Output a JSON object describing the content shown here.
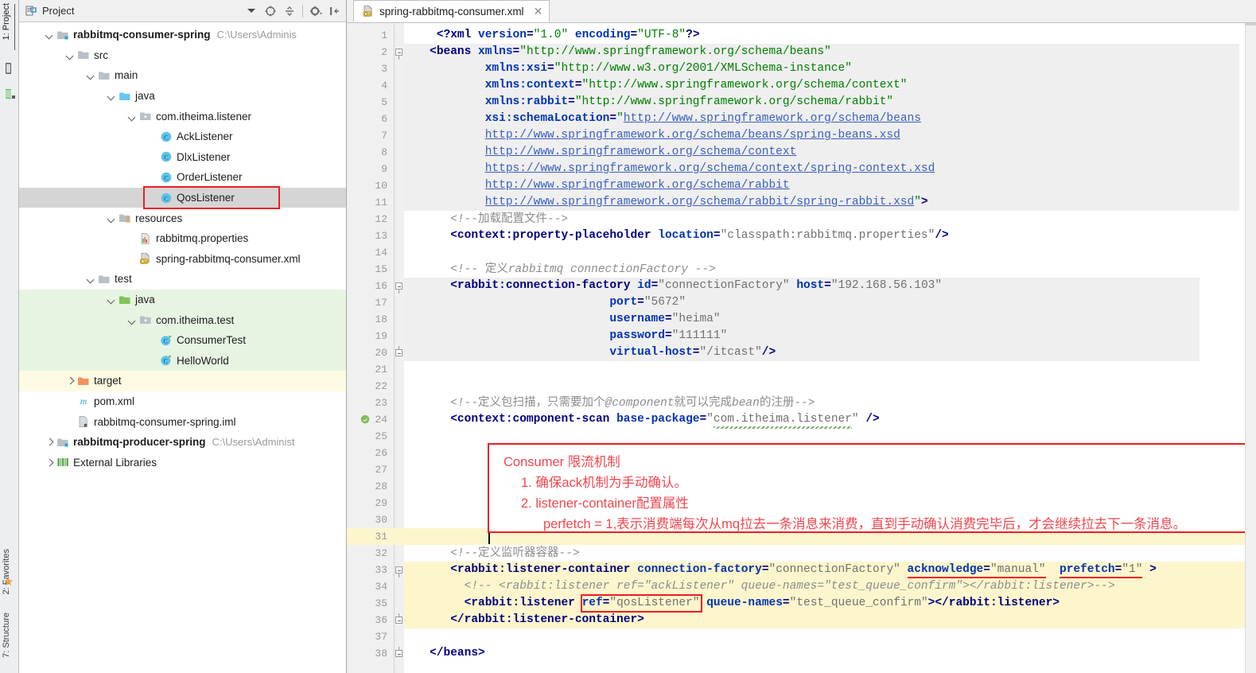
{
  "tool_strip": {
    "tabs": [
      {
        "name": "project",
        "label": "1: Project"
      },
      {
        "name": "favorites",
        "label": "2: Favorites"
      },
      {
        "name": "structure",
        "label": "7: Structure"
      }
    ],
    "star_icon": "star-icon"
  },
  "project_panel": {
    "title": "Project",
    "dropdown_icon": "chevron-down-icon",
    "toolbar_icons": [
      "locate-target-icon",
      "collapse-all-icon",
      "settings-gear-icon",
      "hide-panel-icon"
    ],
    "tree": [
      {
        "depth": 0,
        "arrow": "down",
        "icon": "module-icon",
        "label": "rabbitmq-consumer-spring",
        "bold": true,
        "path": "C:\\Users\\Adminis",
        "state": "normal"
      },
      {
        "depth": 1,
        "arrow": "down",
        "icon": "folder-icon",
        "label": "src",
        "bold": false,
        "path": "",
        "state": "normal"
      },
      {
        "depth": 2,
        "arrow": "down",
        "icon": "folder-icon",
        "label": "main",
        "bold": false,
        "path": "",
        "state": "normal"
      },
      {
        "depth": 3,
        "arrow": "down",
        "icon": "source-root-icon",
        "label": "java",
        "bold": false,
        "path": "",
        "state": "normal"
      },
      {
        "depth": 4,
        "arrow": "down",
        "icon": "package-icon",
        "label": "com.itheima.listener",
        "bold": false,
        "path": "",
        "state": "normal"
      },
      {
        "depth": 5,
        "arrow": "none",
        "icon": "class-icon",
        "label": "AckListener",
        "bold": false,
        "path": "",
        "state": "normal"
      },
      {
        "depth": 5,
        "arrow": "none",
        "icon": "class-icon",
        "label": "DlxListener",
        "bold": false,
        "path": "",
        "state": "normal"
      },
      {
        "depth": 5,
        "arrow": "none",
        "icon": "class-icon",
        "label": "OrderListener",
        "bold": false,
        "path": "",
        "state": "normal"
      },
      {
        "depth": 5,
        "arrow": "none",
        "icon": "class-icon",
        "label": "QosListener",
        "bold": false,
        "path": "",
        "state": "selected"
      },
      {
        "depth": 3,
        "arrow": "down",
        "icon": "resource-root-icon",
        "label": "resources",
        "bold": false,
        "path": "",
        "state": "normal"
      },
      {
        "depth": 4,
        "arrow": "none",
        "icon": "properties-file-icon",
        "label": "rabbitmq.properties",
        "bold": false,
        "path": "",
        "state": "normal"
      },
      {
        "depth": 4,
        "arrow": "none",
        "icon": "spring-xml-icon",
        "label": "spring-rabbitmq-consumer.xml",
        "bold": false,
        "path": "",
        "state": "normal"
      },
      {
        "depth": 2,
        "arrow": "down",
        "icon": "folder-icon",
        "label": "test",
        "bold": false,
        "path": "",
        "state": "normal"
      },
      {
        "depth": 3,
        "arrow": "down",
        "icon": "test-source-root-icon",
        "label": "java",
        "bold": false,
        "path": "",
        "state": "green"
      },
      {
        "depth": 4,
        "arrow": "down",
        "icon": "package-icon",
        "label": "com.itheima.test",
        "bold": false,
        "path": "",
        "state": "green"
      },
      {
        "depth": 5,
        "arrow": "none",
        "icon": "test-class-icon",
        "label": "ConsumerTest",
        "bold": false,
        "path": "",
        "state": "green"
      },
      {
        "depth": 5,
        "arrow": "none",
        "icon": "test-class-icon",
        "label": "HelloWorld",
        "bold": false,
        "path": "",
        "state": "green"
      },
      {
        "depth": 1,
        "arrow": "right",
        "icon": "excluded-folder-icon",
        "label": "target",
        "bold": false,
        "path": "",
        "state": "yellow"
      },
      {
        "depth": 1,
        "arrow": "none",
        "icon": "maven-pom-icon",
        "label": "pom.xml",
        "bold": false,
        "path": "",
        "state": "normal"
      },
      {
        "depth": 1,
        "arrow": "none",
        "icon": "iml-file-icon",
        "label": "rabbitmq-consumer-spring.iml",
        "bold": false,
        "path": "",
        "state": "normal"
      },
      {
        "depth": 0,
        "arrow": "right",
        "icon": "module-icon",
        "label": "rabbitmq-producer-spring",
        "bold": true,
        "path": "C:\\Users\\Administ",
        "state": "normal"
      },
      {
        "depth": 0,
        "arrow": "right",
        "icon": "libraries-icon",
        "label": "External Libraries",
        "bold": false,
        "path": "",
        "state": "normal"
      }
    ],
    "highlight_row_index": 8
  },
  "editor": {
    "tab": {
      "label": "spring-rabbitmq-consumer.xml",
      "icon": "spring-xml-icon",
      "close_icon": "close-icon"
    },
    "first_line": 1,
    "last_line": 38,
    "cursor_line": 31,
    "lines": [
      {
        "n": 1,
        "segs": [
          [
            "plain",
            "    "
          ],
          [
            "punc",
            "<?"
          ],
          [
            "tagname",
            "xml"
          ],
          [
            "plain",
            " "
          ],
          [
            "attr",
            "version"
          ],
          [
            "punc",
            "="
          ],
          [
            "strq",
            "\"1.0\""
          ],
          [
            "plain",
            " "
          ],
          [
            "attr",
            "encoding"
          ],
          [
            "punc",
            "="
          ],
          [
            "strq",
            "\"UTF-8\""
          ],
          [
            "punc",
            "?>"
          ]
        ]
      },
      {
        "n": 2,
        "segs": [
          [
            "plain",
            "   "
          ],
          [
            "punc",
            "<"
          ],
          [
            "tagname",
            "beans"
          ],
          [
            "plain",
            " "
          ],
          [
            "attr",
            "xmlns"
          ],
          [
            "punc",
            "="
          ],
          [
            "strq",
            "\"http://www.springframework.org/schema/beans\""
          ]
        ]
      },
      {
        "n": 3,
        "segs": [
          [
            "plain",
            "           "
          ],
          [
            "attr",
            "xmlns:xsi"
          ],
          [
            "punc",
            "="
          ],
          [
            "strq",
            "\"http://www.w3.org/2001/XMLSchema-instance\""
          ]
        ]
      },
      {
        "n": 4,
        "segs": [
          [
            "plain",
            "           "
          ],
          [
            "attr",
            "xmlns:context"
          ],
          [
            "punc",
            "="
          ],
          [
            "strq",
            "\"http://www.springframework.org/schema/context\""
          ]
        ]
      },
      {
        "n": 5,
        "segs": [
          [
            "plain",
            "           "
          ],
          [
            "attr",
            "xmlns:rabbit"
          ],
          [
            "punc",
            "="
          ],
          [
            "strq",
            "\"http://www.springframework.org/schema/rabbit\""
          ]
        ]
      },
      {
        "n": 6,
        "segs": [
          [
            "plain",
            "           "
          ],
          [
            "attr",
            "xsi:schemaLocation"
          ],
          [
            "punc",
            "="
          ],
          [
            "strq",
            "\""
          ],
          [
            "url",
            "http://www.springframework.org/schema/beans"
          ]
        ]
      },
      {
        "n": 7,
        "segs": [
          [
            "plain",
            "           "
          ],
          [
            "url",
            "http://www.springframework.org/schema/beans/spring-beans.xsd"
          ]
        ]
      },
      {
        "n": 8,
        "segs": [
          [
            "plain",
            "           "
          ],
          [
            "url",
            "http://www.springframework.org/schema/context"
          ]
        ]
      },
      {
        "n": 9,
        "segs": [
          [
            "plain",
            "           "
          ],
          [
            "url",
            "https://www.springframework.org/schema/context/spring-context.xsd"
          ]
        ]
      },
      {
        "n": 10,
        "segs": [
          [
            "plain",
            "           "
          ],
          [
            "url",
            "http://www.springframework.org/schema/rabbit"
          ]
        ]
      },
      {
        "n": 11,
        "segs": [
          [
            "plain",
            "           "
          ],
          [
            "url",
            "http://www.springframework.org/schema/rabbit/spring-rabbit.xsd"
          ],
          [
            "strq",
            "\""
          ],
          [
            "punc",
            ">"
          ]
        ]
      },
      {
        "n": 12,
        "segs": [
          [
            "cmt",
            "      <!--"
          ],
          [
            "cmtcn",
            "加载配置文件"
          ],
          [
            "cmt",
            "-->"
          ]
        ]
      },
      {
        "n": 13,
        "segs": [
          [
            "punc",
            "      <"
          ],
          [
            "tagname",
            "context:property-placeholder"
          ],
          [
            "plain",
            " "
          ],
          [
            "attr",
            "location"
          ],
          [
            "punc",
            "="
          ],
          [
            "greyval",
            "\"classpath:rabbitmq.properties\""
          ],
          [
            "punc",
            "/>"
          ]
        ]
      },
      {
        "n": 14,
        "segs": []
      },
      {
        "n": 15,
        "segs": [
          [
            "cmt",
            "      <!-- "
          ],
          [
            "cmtcn",
            "定义"
          ],
          [
            "cmt",
            "rabbitmq connectionFactory -->"
          ]
        ]
      },
      {
        "n": 16,
        "segs": [
          [
            "punc",
            "      <"
          ],
          [
            "tagname",
            "rabbit:connection-factory"
          ],
          [
            "plain",
            " "
          ],
          [
            "attr",
            "id"
          ],
          [
            "punc",
            "="
          ],
          [
            "greyval",
            "\"connectionFactory\""
          ],
          [
            "plain",
            " "
          ],
          [
            "attr",
            "host"
          ],
          [
            "punc",
            "="
          ],
          [
            "greyval",
            "\"192.168.56.103\""
          ]
        ]
      },
      {
        "n": 17,
        "segs": [
          [
            "plain",
            "                             "
          ],
          [
            "attr",
            "port"
          ],
          [
            "punc",
            "="
          ],
          [
            "greyval",
            "\"5672\""
          ]
        ]
      },
      {
        "n": 18,
        "segs": [
          [
            "plain",
            "                             "
          ],
          [
            "attr",
            "username"
          ],
          [
            "punc",
            "="
          ],
          [
            "greyval",
            "\"heima\""
          ]
        ]
      },
      {
        "n": 19,
        "segs": [
          [
            "plain",
            "                             "
          ],
          [
            "attr",
            "password"
          ],
          [
            "punc",
            "="
          ],
          [
            "greyval",
            "\"111111\""
          ]
        ]
      },
      {
        "n": 20,
        "segs": [
          [
            "plain",
            "                             "
          ],
          [
            "attr",
            "virtual-host"
          ],
          [
            "punc",
            "="
          ],
          [
            "greyval",
            "\"/itcast\""
          ],
          [
            "punc",
            "/>"
          ]
        ]
      },
      {
        "n": 21,
        "segs": []
      },
      {
        "n": 22,
        "segs": []
      },
      {
        "n": 23,
        "segs": [
          [
            "cmt",
            "      <!--"
          ],
          [
            "cmtcn",
            "定义包扫描，只需要加个"
          ],
          [
            "cmt",
            "@component"
          ],
          [
            "cmtcn",
            "就可以完成"
          ],
          [
            "cmt",
            "bean"
          ],
          [
            "cmtcn",
            "的注册"
          ],
          [
            "cmt",
            "-->"
          ]
        ]
      },
      {
        "n": 24,
        "segs": [
          [
            "punc",
            "      <"
          ],
          [
            "tagname",
            "context:component-scan"
          ],
          [
            "plain",
            " "
          ],
          [
            "attr",
            "base-package"
          ],
          [
            "punc",
            "="
          ],
          [
            "greyval",
            "\"com.itheima.listener\""
          ],
          [
            "plain",
            " "
          ],
          [
            "punc",
            "/>"
          ]
        ]
      },
      {
        "n": 25,
        "segs": []
      },
      {
        "n": 26,
        "segs": []
      },
      {
        "n": 27,
        "segs": []
      },
      {
        "n": 28,
        "segs": []
      },
      {
        "n": 29,
        "segs": []
      },
      {
        "n": 30,
        "segs": []
      },
      {
        "n": 31,
        "segs": []
      },
      {
        "n": 32,
        "segs": [
          [
            "cmt",
            "      <!--"
          ],
          [
            "cmtcn",
            "定义监听器容器"
          ],
          [
            "cmt",
            "-->"
          ]
        ]
      },
      {
        "n": 33,
        "segs": [
          [
            "punc",
            "      <"
          ],
          [
            "tagname",
            "rabbit:listener-container"
          ],
          [
            "plain",
            " "
          ],
          [
            "attr",
            "connection-factory"
          ],
          [
            "punc",
            "="
          ],
          [
            "greyval",
            "\"connectionFactory\""
          ],
          [
            "plain",
            " "
          ],
          [
            "attr",
            "acknowledge"
          ],
          [
            "punc",
            "="
          ],
          [
            "greyval",
            "\"manual\""
          ],
          [
            "plain",
            "  "
          ],
          [
            "attr",
            "prefetch"
          ],
          [
            "punc",
            "="
          ],
          [
            "greyval",
            "\"1\""
          ],
          [
            "punc",
            " >"
          ]
        ]
      },
      {
        "n": 34,
        "segs": [
          [
            "cmt",
            "        <!-- <rabbit:listener ref=\"ackListener\" queue-names=\"test_queue_confirm\"></rabbit:listener>-->"
          ]
        ]
      },
      {
        "n": 35,
        "segs": [
          [
            "punc",
            "        <"
          ],
          [
            "tagname",
            "rabbit:listener"
          ],
          [
            "plain",
            " "
          ],
          [
            "attr",
            "ref"
          ],
          [
            "punc",
            "="
          ],
          [
            "greyval",
            "\"qosListener\""
          ],
          [
            "plain",
            " "
          ],
          [
            "attr",
            "queue-names"
          ],
          [
            "punc",
            "="
          ],
          [
            "greyval",
            "\"test_queue_confirm\""
          ],
          [
            "punc",
            "></"
          ],
          [
            "tagname",
            "rabbit:listener"
          ],
          [
            "punc",
            ">"
          ]
        ]
      },
      {
        "n": 36,
        "segs": [
          [
            "punc",
            "      </"
          ],
          [
            "tagname",
            "rabbit:listener-container"
          ],
          [
            "punc",
            ">"
          ]
        ]
      },
      {
        "n": 37,
        "segs": []
      },
      {
        "n": 38,
        "segs": [
          [
            "punc",
            "   </"
          ],
          [
            "tagname",
            "beans"
          ],
          [
            "punc",
            ">"
          ]
        ]
      }
    ],
    "annotation": {
      "title": "Consumer 限流机制",
      "item1": "1. 确保ack机制为手动确认。",
      "item2": "2. listener-container配置属性",
      "item3": "perfetch = 1,表示消费端每次从mq拉去一条消息来消费，直到手动确认消费完毕后，才会继续拉去下一条消息。",
      "border_color": "#ee1c25",
      "text_color": "#f0474e"
    },
    "red_underlines": [
      "acknowledge=\"manual\"",
      "prefetch=\"1\""
    ],
    "red_boxes": [
      "ref=\"qosListener\"",
      "QosListener"
    ],
    "highlight_color": "#fdf6cd"
  }
}
